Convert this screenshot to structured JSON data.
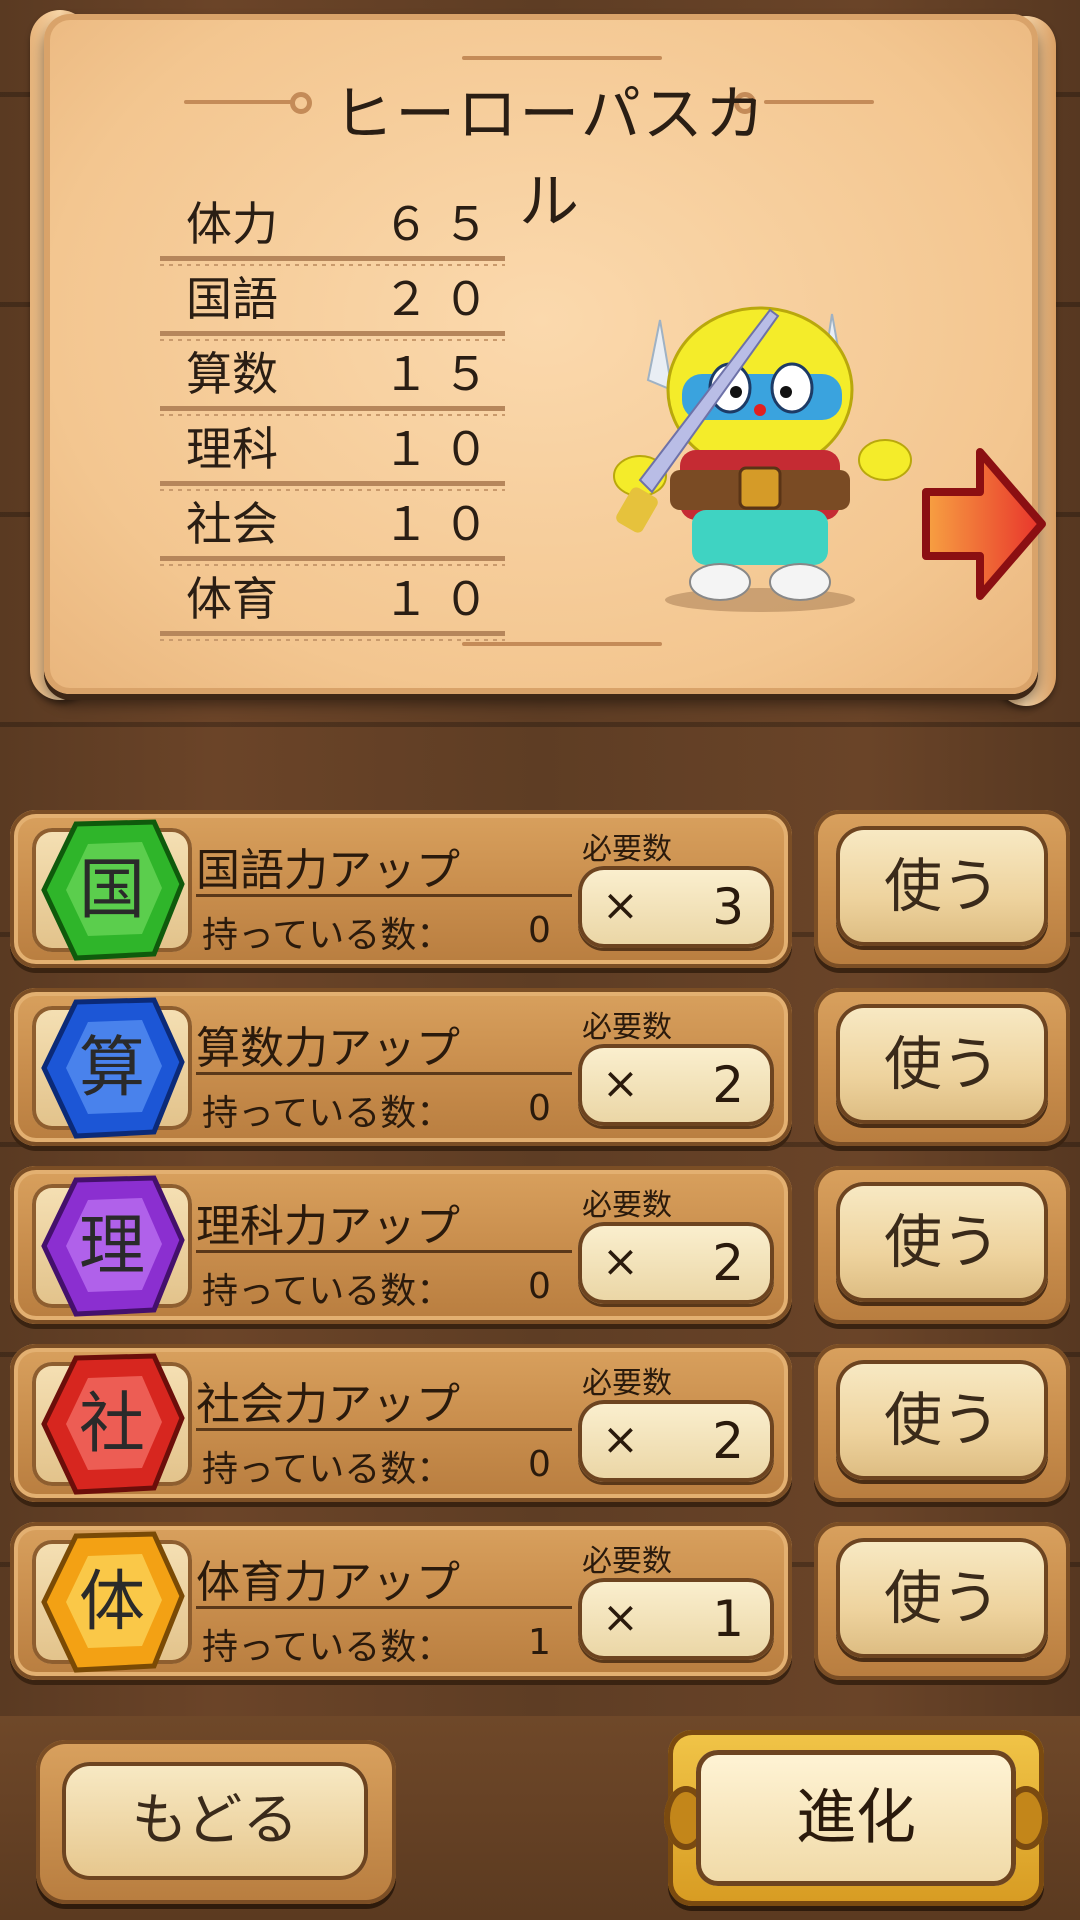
{
  "hero": {
    "name": "ヒーローパスカル",
    "stats": [
      {
        "label": "体力",
        "value": "６５"
      },
      {
        "label": "国語",
        "value": "２０"
      },
      {
        "label": "算数",
        "value": "１５"
      },
      {
        "label": "理科",
        "value": "１０"
      },
      {
        "label": "社会",
        "value": "１０"
      },
      {
        "label": "体育",
        "value": "１０"
      }
    ]
  },
  "items": [
    {
      "gem_char": "国",
      "gem_color": "#2fb52a",
      "name": "国語力アップ",
      "owned_label": "持っている数：",
      "owned": "0",
      "required_label": "必要数",
      "x": "×",
      "required": "3",
      "use_label": "使う"
    },
    {
      "gem_char": "算",
      "gem_color": "#1c56d6",
      "name": "算数力アップ",
      "owned_label": "持っている数：",
      "owned": "0",
      "required_label": "必要数",
      "x": "×",
      "required": "2",
      "use_label": "使う"
    },
    {
      "gem_char": "理",
      "gem_color": "#8b2fd0",
      "name": "理科力アップ",
      "owned_label": "持っている数：",
      "owned": "0",
      "required_label": "必要数",
      "x": "×",
      "required": "2",
      "use_label": "使う"
    },
    {
      "gem_char": "社",
      "gem_color": "#d7261f",
      "name": "社会力アップ",
      "owned_label": "持っている数：",
      "owned": "0",
      "required_label": "必要数",
      "x": "×",
      "required": "2",
      "use_label": "使う"
    },
    {
      "gem_char": "体",
      "gem_color": "#f3a114",
      "name": "体育力アップ",
      "owned_label": "持っている数：",
      "owned": "1",
      "required_label": "必要数",
      "x": "×",
      "required": "1",
      "use_label": "使う"
    }
  ],
  "buttons": {
    "back": "もどる",
    "evolve": "進化"
  },
  "icons": {
    "next": "right-arrow-icon"
  }
}
